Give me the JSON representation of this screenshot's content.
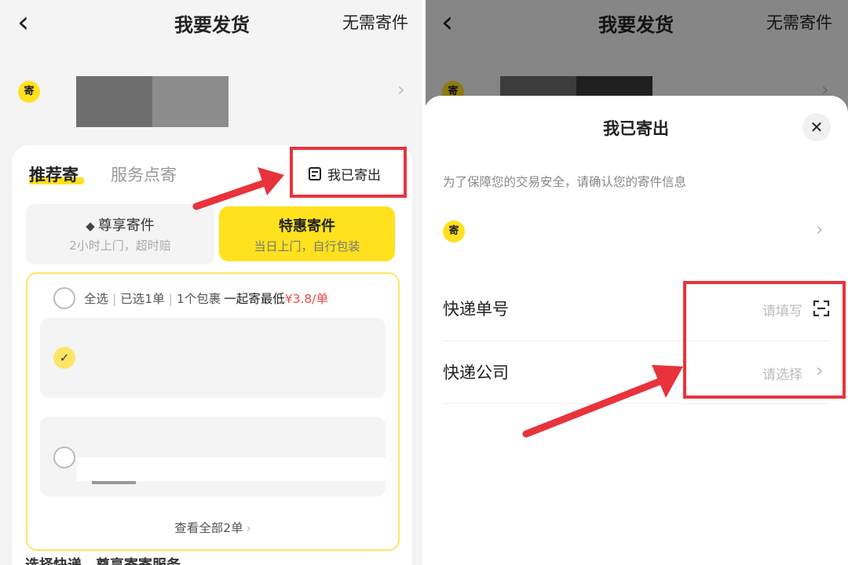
{
  "left": {
    "header": {
      "back_icon": "‹",
      "title": "我要发货",
      "right_action": "无需寄件"
    },
    "sender": {
      "badge": "寄",
      "chevron": "›"
    },
    "tabs": {
      "active": "推荐寄",
      "inactive": "服务点寄",
      "sent_button": "我已寄出"
    },
    "services": [
      {
        "name": "尊享寄件",
        "sub": "2小时上门，超时赔",
        "icon": "diamond-icon"
      },
      {
        "name": "特惠寄件",
        "sub": "当日上门，自行包装"
      }
    ],
    "orders": {
      "select_all": "全选",
      "selected": "已选1单",
      "packages": "1个包裹",
      "promo_prefix": "一起寄最低",
      "promo_price": "¥3.8/单",
      "check_mark": "✓",
      "view_all": "查看全部2单",
      "view_all_arrow": "›"
    },
    "bottom_cut_text": "选择快递，尊享寄寄服务"
  },
  "right": {
    "header": {
      "back_icon": "‹",
      "title": "我要发货",
      "right_action": "无需寄件"
    },
    "sender": {
      "badge": "寄",
      "chevron": "›"
    },
    "sheet": {
      "title": "我已寄出",
      "close": "✕",
      "notice": "为了保障您的交易安全，请确认您的寄件信息",
      "sender_badge": "寄",
      "sender_chevron": "›",
      "fields": [
        {
          "label": "快递单号",
          "placeholder": "请填写",
          "icon": "scan-icon"
        },
        {
          "label": "快递公司",
          "placeholder": "请选择",
          "icon": "chevron-right-icon",
          "chevron": "›"
        }
      ]
    }
  },
  "colors": {
    "accent": "#ffe11e",
    "price": "#e64b4b",
    "annotation": "#e8333c"
  }
}
